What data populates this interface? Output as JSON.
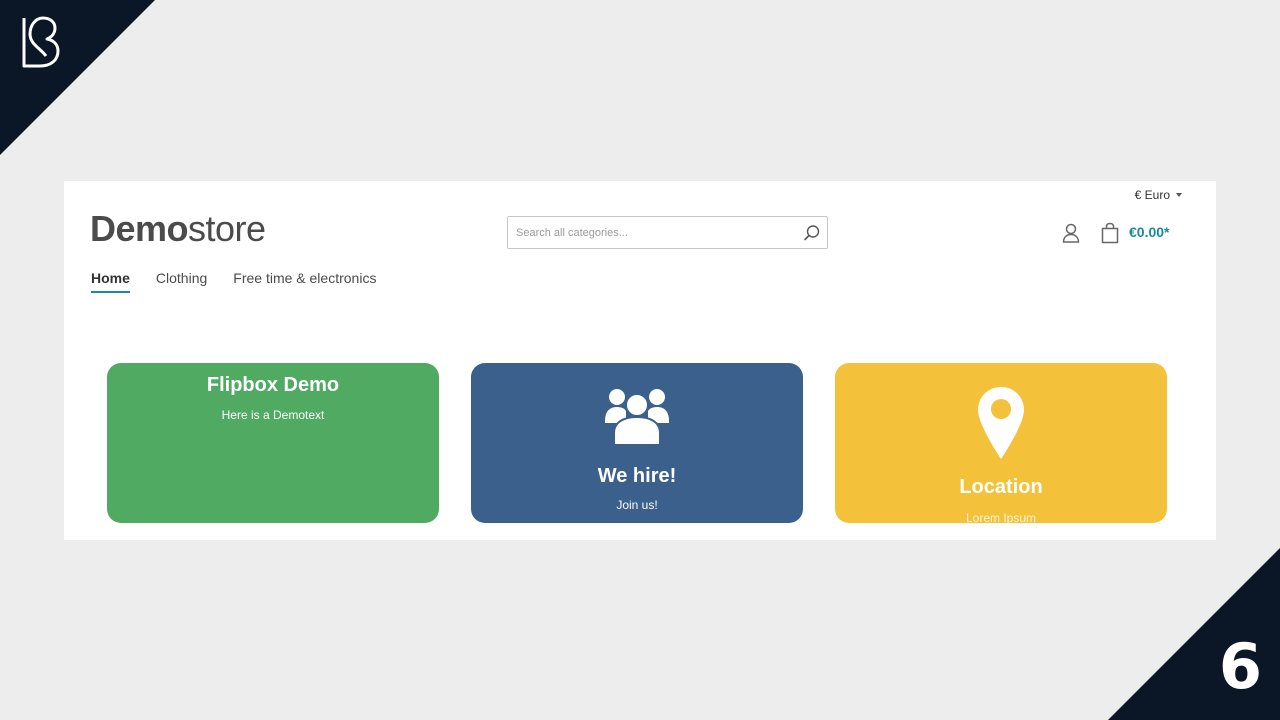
{
  "header": {
    "currency": "€ Euro",
    "brand_bold": "Demo",
    "brand_light": "store",
    "search_placeholder": "Search all categories...",
    "cart_total": "€0.00*"
  },
  "nav": [
    "Home",
    "Clothing",
    "Free time & electronics"
  ],
  "cards": [
    {
      "title": "Flipbox Demo",
      "text": "Here is a Demotext",
      "color": "#50aa62"
    },
    {
      "title": "We hire!",
      "text": "Join us!",
      "color": "#3c608c",
      "icon": "users-icon"
    },
    {
      "title": "Location",
      "text": "Lorem Ipsum",
      "color": "#f3c23a",
      "icon": "map-pin-icon"
    }
  ],
  "badge": "6",
  "accent_color": "#1c8a9a",
  "corner_color": "#0b1626"
}
